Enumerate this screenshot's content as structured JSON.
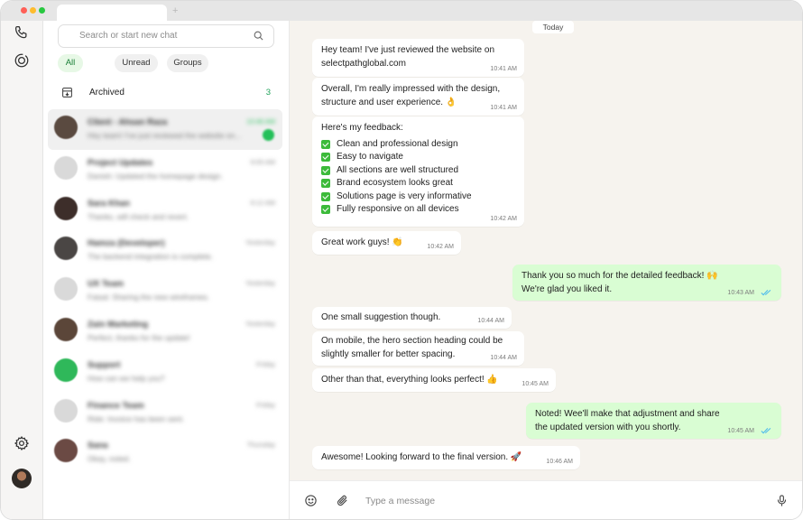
{
  "window": {
    "new_tab_symbol": "+"
  },
  "rail": {
    "icons": [
      "phone-icon",
      "status-icon",
      "settings-icon"
    ]
  },
  "sidebar": {
    "search_placeholder": "Search or start new chat",
    "filters": [
      "All",
      "Unread",
      "Groups"
    ],
    "archived_label": "Archived",
    "archived_count": "3",
    "chats": [
      {
        "name": "Client - Ahsan Raza",
        "preview": "Hey team! I've just reviewed the website on...",
        "time": "10:46 AM",
        "unread": "1"
      },
      {
        "name": "Project Updates",
        "preview": "Danish: Updated the homepage design.",
        "time": "9:05 AM"
      },
      {
        "name": "Sara Khan",
        "preview": "Thanks, will check and revert.",
        "time": "9:12 AM"
      },
      {
        "name": "Hamza (Developer)",
        "preview": "The backend integration is complete.",
        "time": "Yesterday"
      },
      {
        "name": "UX Team",
        "preview": "Faisal: Sharing the new wireframes.",
        "time": "Yesterday"
      },
      {
        "name": "Zain Marketing",
        "preview": "Perfect, thanks for the update!",
        "time": "Yesterday"
      },
      {
        "name": "Support",
        "preview": "How can we help you?",
        "time": "Friday"
      },
      {
        "name": "Finance Team",
        "preview": "Ride: Invoice has been sent.",
        "time": "Friday"
      },
      {
        "name": "Sana",
        "preview": "Okay, noted.",
        "time": "Thursday"
      }
    ]
  },
  "conversation": {
    "day_label": "Today",
    "messages": [
      {
        "dir": "in",
        "lines": [
          "Hey team! I've just reviewed the website on",
          "selectpathglobal.com"
        ],
        "time": "10:41 AM"
      },
      {
        "dir": "in",
        "lines": [
          "Overall, I'm really impressed with the design,",
          "structure and user experience. 👌"
        ],
        "time": "10:41 AM"
      },
      {
        "dir": "in",
        "heading": "Here's my feedback:",
        "checklist": [
          "Clean and professional design",
          "Easy to navigate",
          "All sections are well structured",
          "Brand ecosystem looks great",
          "Solutions page is very informative",
          "Fully responsive on all devices"
        ],
        "time": "10:42 AM"
      },
      {
        "dir": "in",
        "lines": [
          "Great work guys! 👏"
        ],
        "time": "10:42 AM"
      },
      {
        "dir": "out",
        "lines": [
          "Thank you so much for the detailed feedback! 🙌",
          "We're glad you liked it."
        ],
        "time": "10:43 AM"
      },
      {
        "dir": "in",
        "lines": [
          "One small suggestion though."
        ],
        "time": "10:44 AM"
      },
      {
        "dir": "in",
        "lines": [
          "On mobile, the hero section heading could be",
          "slightly smaller for better spacing."
        ],
        "time": "10:44 AM"
      },
      {
        "dir": "in",
        "lines": [
          "Other than that, everything looks perfect! 👍"
        ],
        "time": "10:45 AM"
      },
      {
        "dir": "out",
        "lines": [
          "Noted! Wee'll make that adjustment and share",
          "the updated version with you shortly."
        ],
        "time": "10:45 AM"
      },
      {
        "dir": "in",
        "lines": [
          "Awesome! Looking forward to the final version. 🚀"
        ],
        "time": "10:46 AM"
      }
    ]
  },
  "composer": {
    "placeholder": "Type a message",
    "icons": [
      "emoji-icon",
      "attach-icon",
      "microphone-icon"
    ]
  },
  "colors": {
    "accent": "#25c05a",
    "outgoing_bubble": "#d9fdd3",
    "chat_background": "#f6f3ee",
    "read_ticks": "#53bdeb"
  }
}
